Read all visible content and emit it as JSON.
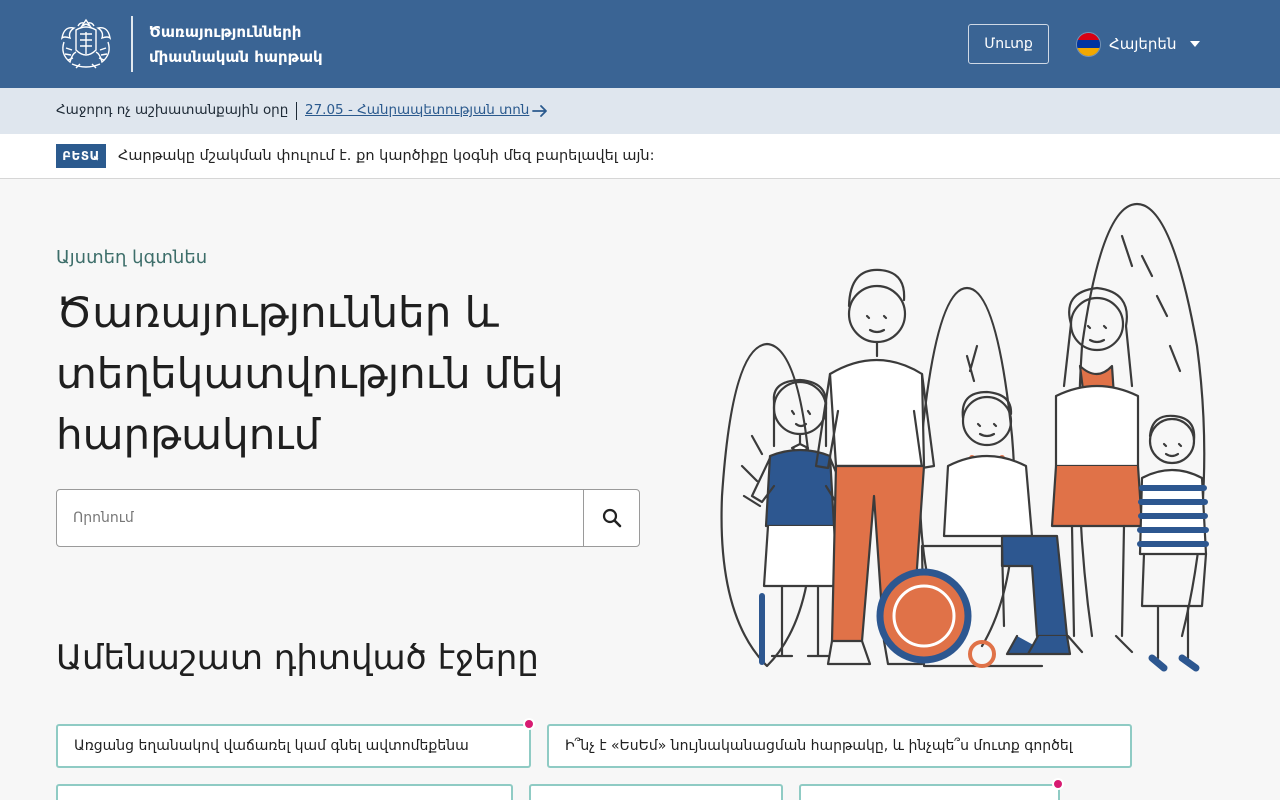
{
  "header": {
    "title_line1": "Ծառայությունների",
    "title_line2": "միասնական հարթակ",
    "login_label": "Մուտք",
    "language_label": "Հայերեն",
    "brand_color": "#3a6494"
  },
  "subbar": {
    "text": "Հաջորդ ոչ աշխատանքային օրը",
    "link": "27.05 - Հանրապետության տոն"
  },
  "beta": {
    "badge": "ԲԵՏԱ",
    "text": "Հարթակը մշակման փուլում է․ քո կարծիքը կօգնի մեզ բարելավել այն:"
  },
  "hero": {
    "kicker": "Այստեղ կգտնես",
    "title": "Ծառայություններ և տեղեկատվություն մեկ հարթակում"
  },
  "search": {
    "placeholder": "Որոնում"
  },
  "popular": {
    "title": "Ամենաշատ դիտված էջերը",
    "items": [
      "Առցանց եղանակով վաճառել կամ գնել ավտոմեքենա",
      "Ի՞նչ է «ԵսԵմ» նույնականացման հարթակը, և ինչպե՞ս մուտք գործել",
      "",
      "",
      ""
    ]
  }
}
